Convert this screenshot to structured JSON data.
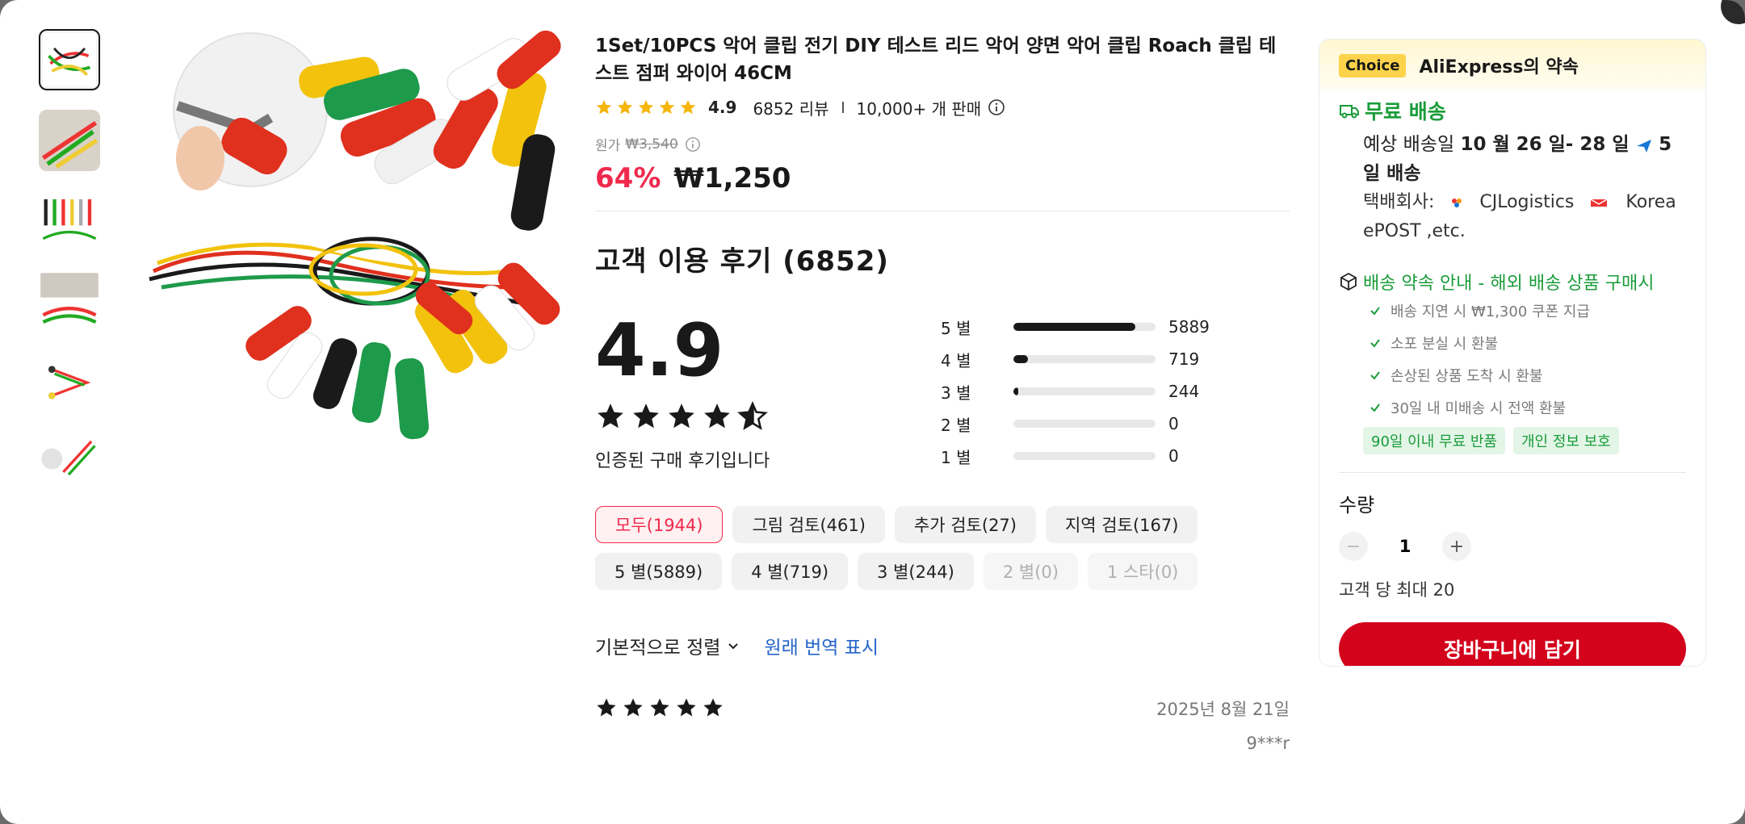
{
  "product": {
    "title": "1Set/10PCS 악어 클립 전기 DIY 테스트 리드 악어 양면 악어 클립 Roach 클립 테스트 점퍼 와이어 46CM",
    "rating": "4.9",
    "review_count": "6852 리뷰",
    "sold": "10,000+ 개 판매",
    "original_label": "원가",
    "original_price": "₩3,540",
    "discount": "64%",
    "price": "₩1,250"
  },
  "reviews": {
    "heading": "고객 이용 후기 (6852)",
    "score": "4.9",
    "star_fill": 0.9,
    "verified": "인증된 구매 후기입니다",
    "distribution": [
      {
        "label": "5 별",
        "count": "5889",
        "fraction": 0.859
      },
      {
        "label": "4 별",
        "count": "719",
        "fraction": 0.105
      },
      {
        "label": "3 별",
        "count": "244",
        "fraction": 0.036
      },
      {
        "label": "2 별",
        "count": "0",
        "fraction": 0
      },
      {
        "label": "1 별",
        "count": "0",
        "fraction": 0
      }
    ],
    "filters": [
      {
        "label": "모두(1944)",
        "state": "active"
      },
      {
        "label": "그림 검토(461)",
        "state": "normal"
      },
      {
        "label": "추가 검토(27)",
        "state": "normal"
      },
      {
        "label": "지역 검토(167)",
        "state": "normal"
      },
      {
        "label": "5 별(5889)",
        "state": "normal"
      },
      {
        "label": "4 별(719)",
        "state": "normal"
      },
      {
        "label": "3 별(244)",
        "state": "normal"
      },
      {
        "label": "2 별(0)",
        "state": "disabled"
      },
      {
        "label": "1 스타(0)",
        "state": "disabled"
      }
    ],
    "sort_label": "기본적으로 정렬",
    "translate_label": "원래 번역 표시",
    "first_review": {
      "stars": 5,
      "date": "2025년 8월 21일",
      "user": "9***r"
    }
  },
  "panel": {
    "choice_badge": "Choice",
    "promise": "AliExpress의 약속",
    "shipping_title": "무료 배송",
    "delivery_prefix": "예상 배송일",
    "delivery_dates": "10 월 26 일- 28 일",
    "delivery_days": "5 일 배송",
    "courier_prefix": "택배회사:",
    "courier_1": "CJLogistics",
    "courier_2": "Korea ePOST ,etc.",
    "guarantee_title": "배송 약속 안내 - 해외 배송 상품 구매시",
    "guarantees": [
      "배송 지연 시 ₩1,300 쿠폰 지급",
      "소포 분실 시 환불",
      "손상된 상품 도착 시 환불",
      "30일 내 미배송 시 전액 환불"
    ],
    "tags": [
      "90일 이내 무료 반품",
      "개인 정보 보호"
    ],
    "qty_label": "수량",
    "qty_value": "1",
    "max_note": "고객 당 최대 20",
    "cart_label": "장바구니에 담기"
  },
  "colors": {
    "accent_red": "#ef2a4d",
    "cart_red": "#d3031c",
    "star_gold": "#f5b50a",
    "green": "#1a9c3a",
    "link_blue": "#2563c9"
  },
  "icons": [
    "star-icon",
    "info-icon",
    "chevron-down-icon",
    "truck-icon",
    "airplane-icon",
    "box-icon",
    "check-icon",
    "close-icon"
  ]
}
